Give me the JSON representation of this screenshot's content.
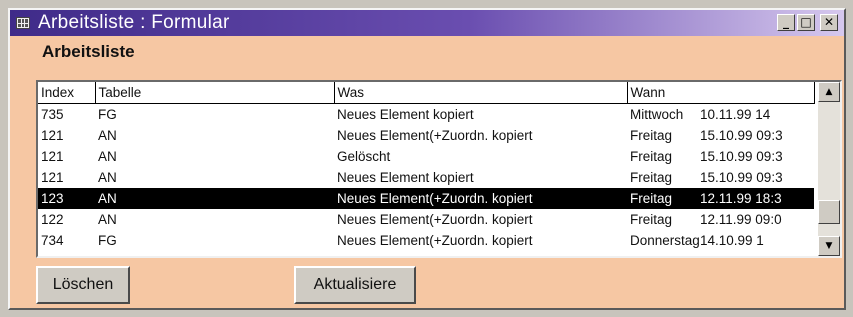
{
  "window": {
    "title": "Arbeitsliste : Formular"
  },
  "window_buttons": {
    "minimize": "_",
    "maximize": "□",
    "close": "✕"
  },
  "form": {
    "title": "Arbeitsliste"
  },
  "list": {
    "columns": [
      "Index",
      "Tabelle",
      "Was",
      "Wann"
    ],
    "rows": [
      {
        "index": "735",
        "tabelle": "FG",
        "was": "Neues Element kopiert",
        "wann_day": "Mittwoch",
        "wann_date": "10.11.99 14",
        "selected": false
      },
      {
        "index": "121",
        "tabelle": "AN",
        "was": "Neues Element(+Zuordn. kopiert",
        "wann_day": "Freitag",
        "wann_date": "15.10.99 09:3",
        "selected": false
      },
      {
        "index": "121",
        "tabelle": "AN",
        "was": "Gelöscht",
        "wann_day": "Freitag",
        "wann_date": "15.10.99 09:3",
        "selected": false
      },
      {
        "index": "121",
        "tabelle": "AN",
        "was": "Neues Element kopiert",
        "wann_day": "Freitag",
        "wann_date": "15.10.99 09:3",
        "selected": false
      },
      {
        "index": "123",
        "tabelle": "AN",
        "was": "Neues Element(+Zuordn. kopiert",
        "wann_day": "Freitag",
        "wann_date": "12.11.99 18:3",
        "selected": true
      },
      {
        "index": "122",
        "tabelle": "AN",
        "was": "Neues Element(+Zuordn. kopiert",
        "wann_day": "Freitag",
        "wann_date": "12.11.99 09:0",
        "selected": false
      },
      {
        "index": "734",
        "tabelle": "FG",
        "was": "Neues Element(+Zuordn. kopiert",
        "wann_day": "Donnerstag",
        "wann_date": "14.10.99 1",
        "selected": false
      }
    ]
  },
  "scrollbar": {
    "up": "▲",
    "down": "▼"
  },
  "buttons": {
    "loeschen": "Löschen",
    "aktualisiere": "Aktualisiere"
  }
}
